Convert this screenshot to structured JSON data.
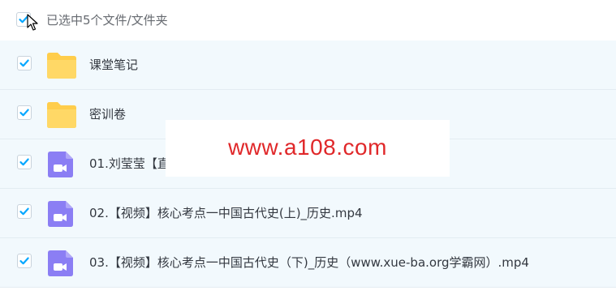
{
  "header": {
    "selection_text": "已选中5个文件/文件夹",
    "select_all_checked": true
  },
  "files": [
    {
      "name": "课堂笔记",
      "type": "folder",
      "icon": "folder-icon",
      "checked": true
    },
    {
      "name": "密训卷",
      "type": "folder",
      "icon": "folder-icon",
      "checked": true
    },
    {
      "name": "01.刘莹莹【直",
      "type": "video",
      "icon": "video-file-icon",
      "checked": true
    },
    {
      "name": "02.【视频】核心考点一中国古代史(上)_历史.mp4",
      "type": "video",
      "icon": "video-file-icon",
      "checked": true
    },
    {
      "name": "03.【视频】核心考点一中国古代史（下)_历史（www.xue-ba.org学霸网）.mp4",
      "type": "video",
      "icon": "video-file-icon",
      "checked": true
    }
  ],
  "watermark": {
    "text": "www.a108.com"
  },
  "colors": {
    "accent": "#06a7ff",
    "folder": "#ffcd4b",
    "video": "#8b7ef4",
    "row_bg": "#f2f9fd",
    "watermark": "#e0282a"
  }
}
